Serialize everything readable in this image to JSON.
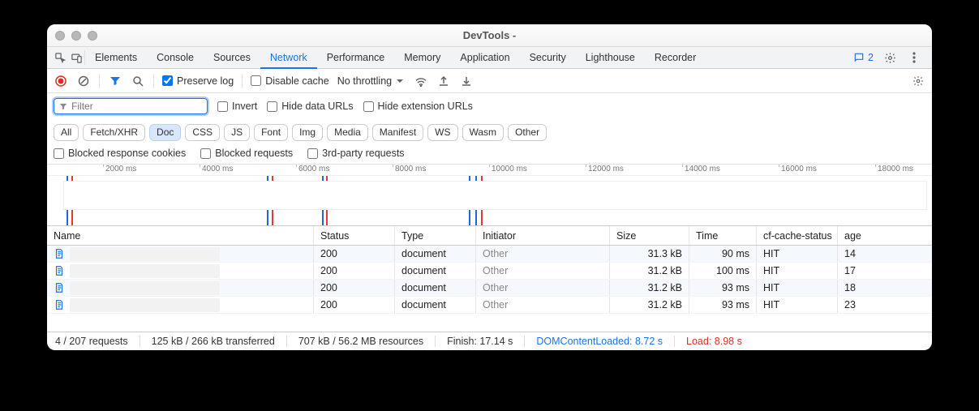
{
  "window": {
    "title": "DevTools -"
  },
  "tabs": {
    "items": [
      "Elements",
      "Console",
      "Sources",
      "Network",
      "Performance",
      "Memory",
      "Application",
      "Security",
      "Lighthouse",
      "Recorder"
    ],
    "active": "Network",
    "message_count": "2"
  },
  "toolbar": {
    "preserve_log": "Preserve log",
    "disable_cache": "Disable cache",
    "throttling": "No throttling"
  },
  "filter": {
    "placeholder": "Filter",
    "invert": "Invert",
    "hide_data_urls": "Hide data URLs",
    "hide_ext_urls": "Hide extension URLs",
    "types": [
      "All",
      "Fetch/XHR",
      "Doc",
      "CSS",
      "JS",
      "Font",
      "Img",
      "Media",
      "Manifest",
      "WS",
      "Wasm",
      "Other"
    ],
    "active_type": "Doc",
    "blocked_cookies": "Blocked response cookies",
    "blocked_requests": "Blocked requests",
    "third_party": "3rd-party requests"
  },
  "timeline": {
    "ticks": [
      "2000 ms",
      "4000 ms",
      "6000 ms",
      "8000 ms",
      "10000 ms",
      "12000 ms",
      "14000 ms",
      "16000 ms",
      "18000 ms"
    ]
  },
  "columns": {
    "name": "Name",
    "status": "Status",
    "type": "Type",
    "initiator": "Initiator",
    "size": "Size",
    "time": "Time",
    "cache": "cf-cache-status",
    "age": "age"
  },
  "rows": [
    {
      "status": "200",
      "type": "document",
      "initiator": "Other",
      "size": "31.3 kB",
      "time": "90 ms",
      "cache": "HIT",
      "age": "14"
    },
    {
      "status": "200",
      "type": "document",
      "initiator": "Other",
      "size": "31.2 kB",
      "time": "100 ms",
      "cache": "HIT",
      "age": "17"
    },
    {
      "status": "200",
      "type": "document",
      "initiator": "Other",
      "size": "31.2 kB",
      "time": "93 ms",
      "cache": "HIT",
      "age": "18"
    },
    {
      "status": "200",
      "type": "document",
      "initiator": "Other",
      "size": "31.2 kB",
      "time": "93 ms",
      "cache": "HIT",
      "age": "23"
    }
  ],
  "footer": {
    "requests": "4 / 207 requests",
    "transferred": "125 kB / 266 kB transferred",
    "resources": "707 kB / 56.2 MB resources",
    "finish": "Finish: 17.14 s",
    "dcl": "DOMContentLoaded: 8.72 s",
    "load": "Load: 8.98 s"
  }
}
